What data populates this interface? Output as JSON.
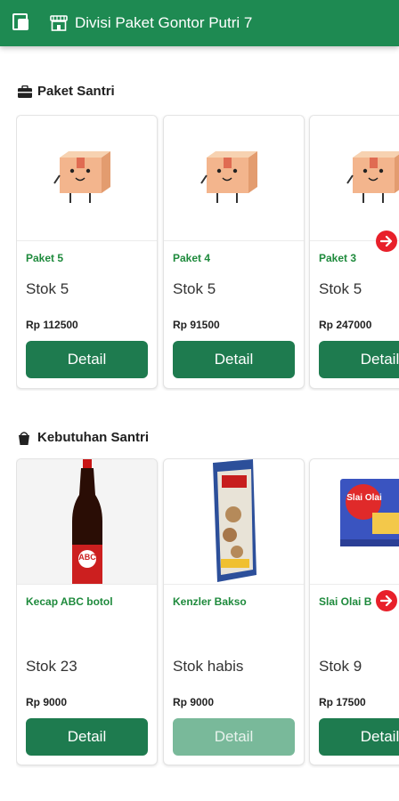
{
  "header": {
    "title": "Divisi Paket Gontor Putri 7",
    "menu_icon": "copy-menu-icon",
    "store_icon": "store-icon",
    "color": "#1e8a52"
  },
  "sections": [
    {
      "title": "Paket Santri",
      "icon": "briefcase-icon",
      "items": [
        {
          "name": "Paket 5",
          "stock": "Stok 5",
          "price": "Rp 112500",
          "button": "Detail"
        },
        {
          "name": "Paket 4",
          "stock": "Stok 5",
          "price": "Rp 91500",
          "button": "Detail"
        },
        {
          "name": "Paket 3",
          "stock": "Stok 5",
          "price": "Rp 247000",
          "button": "Detail"
        }
      ]
    },
    {
      "title": "Kebutuhan Santri",
      "icon": "bucket-icon",
      "items": [
        {
          "name": "Kecap ABC botol",
          "stock": "Stok 23",
          "price": "Rp 9000",
          "button": "Detail",
          "image_label": "ABC"
        },
        {
          "name": "Kenzler Bakso",
          "stock": "Stok habis",
          "price": "Rp 9000",
          "button": "Detail"
        },
        {
          "name": "Slai Olai B",
          "stock": "Stok 9",
          "price": "Rp 17500",
          "button": "Detail",
          "image_label": "Slai Olai"
        }
      ]
    }
  ],
  "accent_red": "#e8202a"
}
